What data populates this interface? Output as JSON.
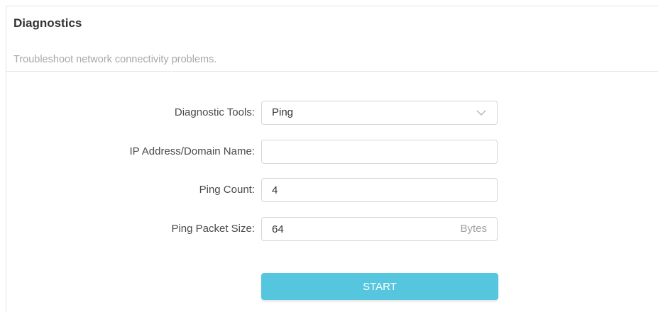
{
  "header": {
    "title": "Diagnostics",
    "subtitle": "Troubleshoot network connectivity problems."
  },
  "form": {
    "diagnostic_tools": {
      "label": "Diagnostic Tools:",
      "value": "Ping",
      "icon": "chevron-down-icon"
    },
    "ip_address": {
      "label": "IP Address/Domain Name:",
      "value": "",
      "placeholder": ""
    },
    "ping_count": {
      "label": "Ping Count:",
      "value": "4"
    },
    "ping_packet_size": {
      "label": "Ping Packet Size:",
      "value": "64",
      "unit": "Bytes"
    }
  },
  "actions": {
    "start_label": "START"
  },
  "colors": {
    "accent": "#56c6df",
    "border": "#d6d6d6",
    "muted_text": "#a8a8a8"
  }
}
